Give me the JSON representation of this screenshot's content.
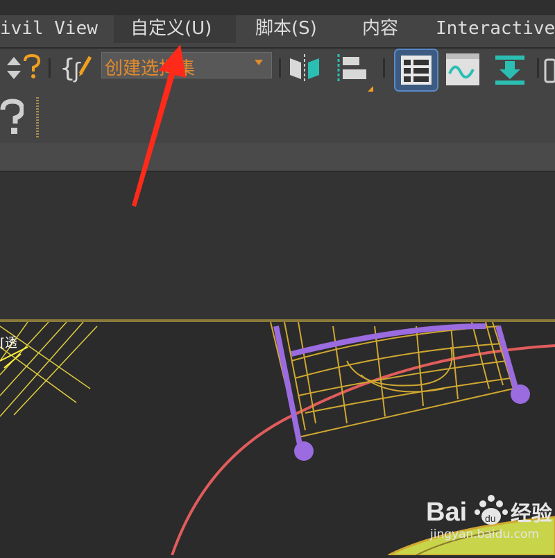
{
  "menu": {
    "items": [
      {
        "label": "ivil View"
      },
      {
        "label": "自定义(U)"
      },
      {
        "label": "脚本(S)"
      },
      {
        "label": "内容"
      },
      {
        "label": "Interactive"
      }
    ]
  },
  "toolbar": {
    "named_selection_placeholder": "创建选择集",
    "accent_color": "#e08a2e",
    "icons": [
      "help-arrows-icon",
      "edit-named-selection-icon",
      "mirror-icon",
      "align-icon",
      "scene-explorer-icon",
      "curve-editor-icon",
      "render-setup-icon",
      "help-question-icon"
    ]
  },
  "viewport": {
    "label_fragment": "[透",
    "colors": {
      "wireframe_yellow": "#d0a830",
      "selection_purple": "#9b6be0",
      "circle_red": "#e25c5c",
      "ground_green": "#c8d44a"
    }
  },
  "annotation": {
    "arrow_color": "#ff2a1a"
  },
  "watermark": {
    "brand": "Bai",
    "suffix": "经验",
    "url": "jingyan.baidu.com"
  }
}
